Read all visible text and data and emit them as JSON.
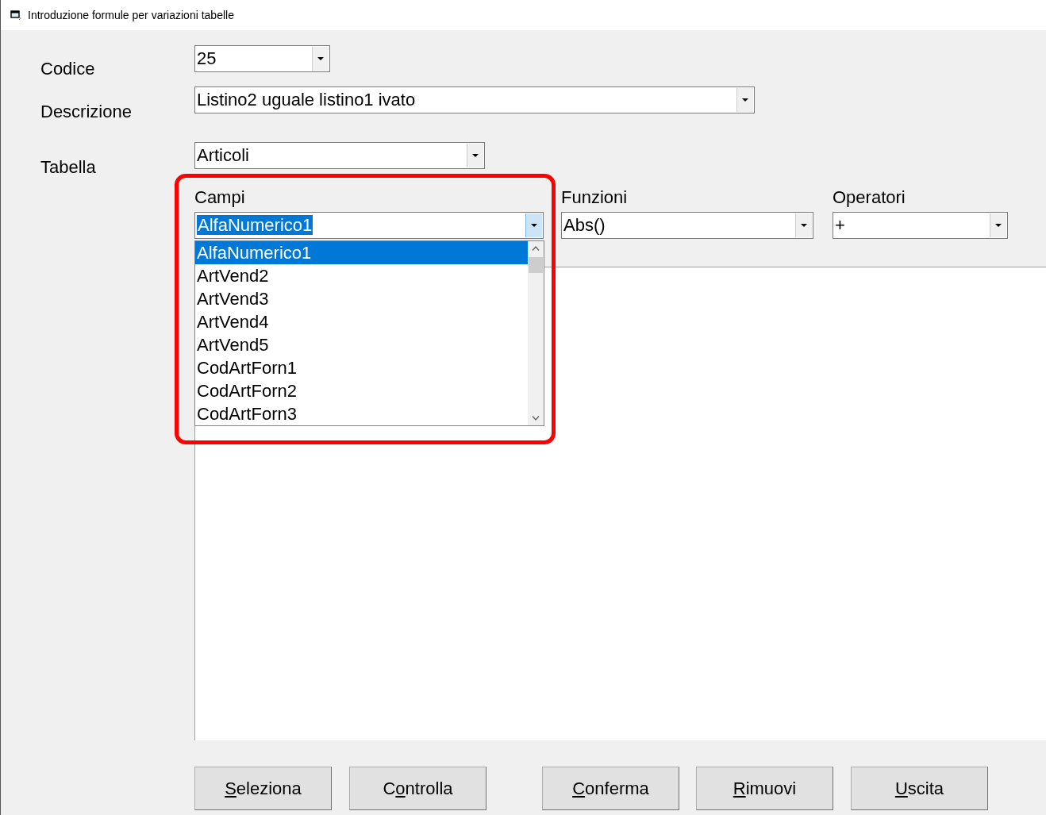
{
  "window": {
    "title": "Introduzione formule per variazioni tabelle"
  },
  "fields": [
    {
      "label": "Codice",
      "value": "25"
    },
    {
      "label": "Descrizione",
      "value": "Listino2 uguale listino1 ivato"
    },
    {
      "label": "Tabella",
      "value": "Articoli"
    }
  ],
  "pickers": [
    {
      "label": "Campi",
      "value": "AlfaNumerico1",
      "focused": true,
      "expanded": true,
      "options": [
        {
          "text": "AlfaNumerico1",
          "selected": true
        },
        {
          "text": "ArtVend2",
          "selected": false
        },
        {
          "text": "ArtVend3",
          "selected": false
        },
        {
          "text": "ArtVend4",
          "selected": false
        },
        {
          "text": "ArtVend5",
          "selected": false
        },
        {
          "text": "CodArtForn1",
          "selected": false
        },
        {
          "text": "CodArtForn2",
          "selected": false
        },
        {
          "text": "CodArtForn3",
          "selected": false
        }
      ]
    },
    {
      "label": "Funzioni",
      "value": "Abs()",
      "focused": false,
      "expanded": false
    },
    {
      "label": "Operatori",
      "value": "+",
      "focused": false,
      "expanded": false
    }
  ],
  "buttons": [
    {
      "key": "S",
      "after": "eleziona"
    },
    {
      "before": "C",
      "key": "o",
      "after": "ntrolla"
    },
    {
      "key": "C",
      "after": "onferma"
    },
    {
      "key": "R",
      "after": "imuovi"
    },
    {
      "key": "U",
      "after": "scita"
    }
  ]
}
